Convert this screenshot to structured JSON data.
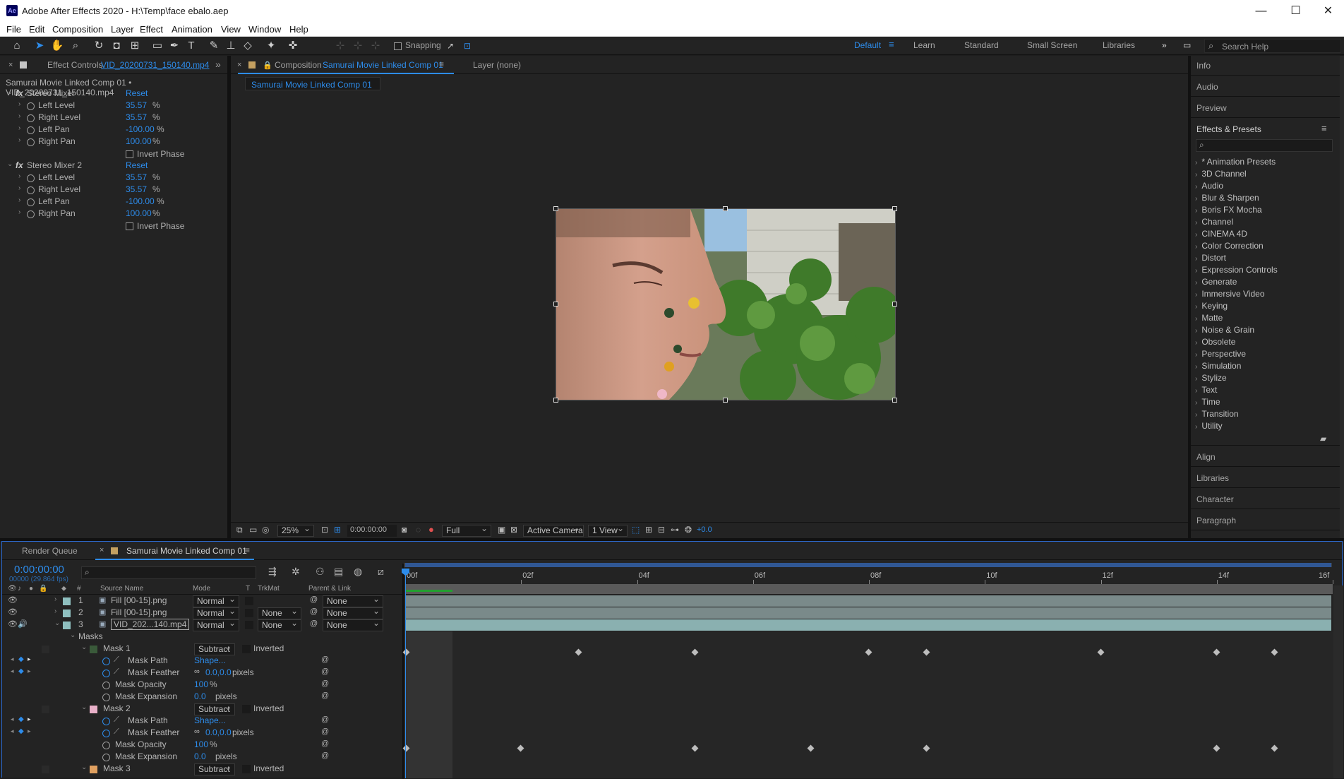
{
  "app": {
    "title": "Adobe After Effects 2020 - H:\\Temp\\face ebalo.aep",
    "icon": "Ae"
  },
  "window_controls": {
    "minimize": "—",
    "maximize": "☐",
    "close": "✕"
  },
  "menu": [
    "File",
    "Edit",
    "Composition",
    "Layer",
    "Effect",
    "Animation",
    "View",
    "Window",
    "Help"
  ],
  "toolbar": {
    "snapping_label": "Snapping",
    "workspaces": [
      "Default",
      "Learn",
      "Standard",
      "Small Screen",
      "Libraries"
    ],
    "active_workspace": "Default",
    "search_placeholder": "Search Help"
  },
  "effect_controls": {
    "tab_prefix": "Effect Controls",
    "tab_file": "VID_20200731_150140.mp4",
    "subtitle": "Samurai Movie Linked Comp 01 • VID_20200731_150140.mp4",
    "effects": [
      {
        "name": "Stereo Mixer",
        "reset": "Reset",
        "params": [
          {
            "name": "Left Level",
            "value": "35.57",
            "unit": "%"
          },
          {
            "name": "Right Level",
            "value": "35.57",
            "unit": "%"
          },
          {
            "name": "Left Pan",
            "value": "-100.00",
            "unit": "%"
          },
          {
            "name": "Right Pan",
            "value": "100.00",
            "unit": "%"
          }
        ],
        "invert": "Invert Phase"
      },
      {
        "name": "Stereo Mixer 2",
        "reset": "Reset",
        "params": [
          {
            "name": "Left Level",
            "value": "35.57",
            "unit": "%"
          },
          {
            "name": "Right Level",
            "value": "35.57",
            "unit": "%"
          },
          {
            "name": "Left Pan",
            "value": "-100.00",
            "unit": "%"
          },
          {
            "name": "Right Pan",
            "value": "100.00",
            "unit": "%"
          }
        ],
        "invert": "Invert Phase"
      }
    ]
  },
  "composition": {
    "tab_prefix": "Composition",
    "tab_name": "Samurai Movie Linked Comp 01",
    "layer_tab": "Layer (none)",
    "breadcrumb": "Samurai Movie Linked Comp 01",
    "footer": {
      "zoom": "25%",
      "timecode": "0:00:00:00",
      "resolution": "Full",
      "camera": "Active Camera",
      "views": "1 View",
      "exposure": "+0.0"
    }
  },
  "right_panels": {
    "top": [
      "Info",
      "Audio",
      "Preview"
    ],
    "effects_title": "Effects & Presets",
    "search_placeholder": "",
    "categories": [
      "* Animation Presets",
      "3D Channel",
      "Audio",
      "Blur & Sharpen",
      "Boris FX Mocha",
      "Channel",
      "CINEMA 4D",
      "Color Correction",
      "Distort",
      "Expression Controls",
      "Generate",
      "Immersive Video",
      "Keying",
      "Matte",
      "Noise & Grain",
      "Obsolete",
      "Perspective",
      "Simulation",
      "Stylize",
      "Text",
      "Time",
      "Transition",
      "Utility"
    ],
    "bottom": [
      "Align",
      "Libraries",
      "Character",
      "Paragraph"
    ]
  },
  "timeline": {
    "tabs": [
      "Render Queue",
      "Samurai Movie Linked Comp 01"
    ],
    "timecode": "0:00:00:00",
    "frame_info": "00000 (29.864 fps)",
    "columns": {
      "num": "#",
      "source": "Source Name",
      "mode": "Mode",
      "t": "T",
      "trkmat": "TrkMat",
      "parent": "Parent & Link"
    },
    "ruler": [
      "00f",
      "02f",
      "04f",
      "06f",
      "08f",
      "10f",
      "12f",
      "14f",
      "16f"
    ],
    "layers": [
      {
        "num": "1",
        "name": "Fill [00-15].png",
        "mode": "Normal",
        "trkmat": "",
        "parent": "None",
        "color": "#8fc0c0"
      },
      {
        "num": "2",
        "name": "Fill [00-15].png",
        "mode": "Normal",
        "trkmat": "None",
        "parent": "None",
        "color": "#8fc0c0"
      },
      {
        "num": "3",
        "name": "VID_202...140.mp4",
        "mode": "Normal",
        "trkmat": "None",
        "parent": "None",
        "color": "#8fc0c0"
      }
    ],
    "masks_label": "Masks",
    "masks": [
      {
        "name": "Mask 1",
        "mode": "Subtract",
        "inverted": "Inverted",
        "color": "#3a5a3a",
        "props": [
          {
            "name": "Mask Path",
            "value": "Shape...",
            "unit": ""
          },
          {
            "name": "Mask Feather",
            "value": "0.0,0.0",
            "unit": "pixels"
          },
          {
            "name": "Mask Opacity",
            "value": "100",
            "unit": "%"
          },
          {
            "name": "Mask Expansion",
            "value": "0.0",
            "unit": "pixels"
          }
        ]
      },
      {
        "name": "Mask 2",
        "mode": "Subtract",
        "inverted": "Inverted",
        "color": "#e8b0c8",
        "props": [
          {
            "name": "Mask Path",
            "value": "Shape...",
            "unit": ""
          },
          {
            "name": "Mask Feather",
            "value": "0.0,0.0",
            "unit": "pixels"
          },
          {
            "name": "Mask Opacity",
            "value": "100",
            "unit": "%"
          },
          {
            "name": "Mask Expansion",
            "value": "0.0",
            "unit": "pixels"
          }
        ]
      },
      {
        "name": "Mask 3",
        "mode": "Subtract",
        "inverted": "Inverted",
        "color": "#e0a060"
      }
    ]
  }
}
